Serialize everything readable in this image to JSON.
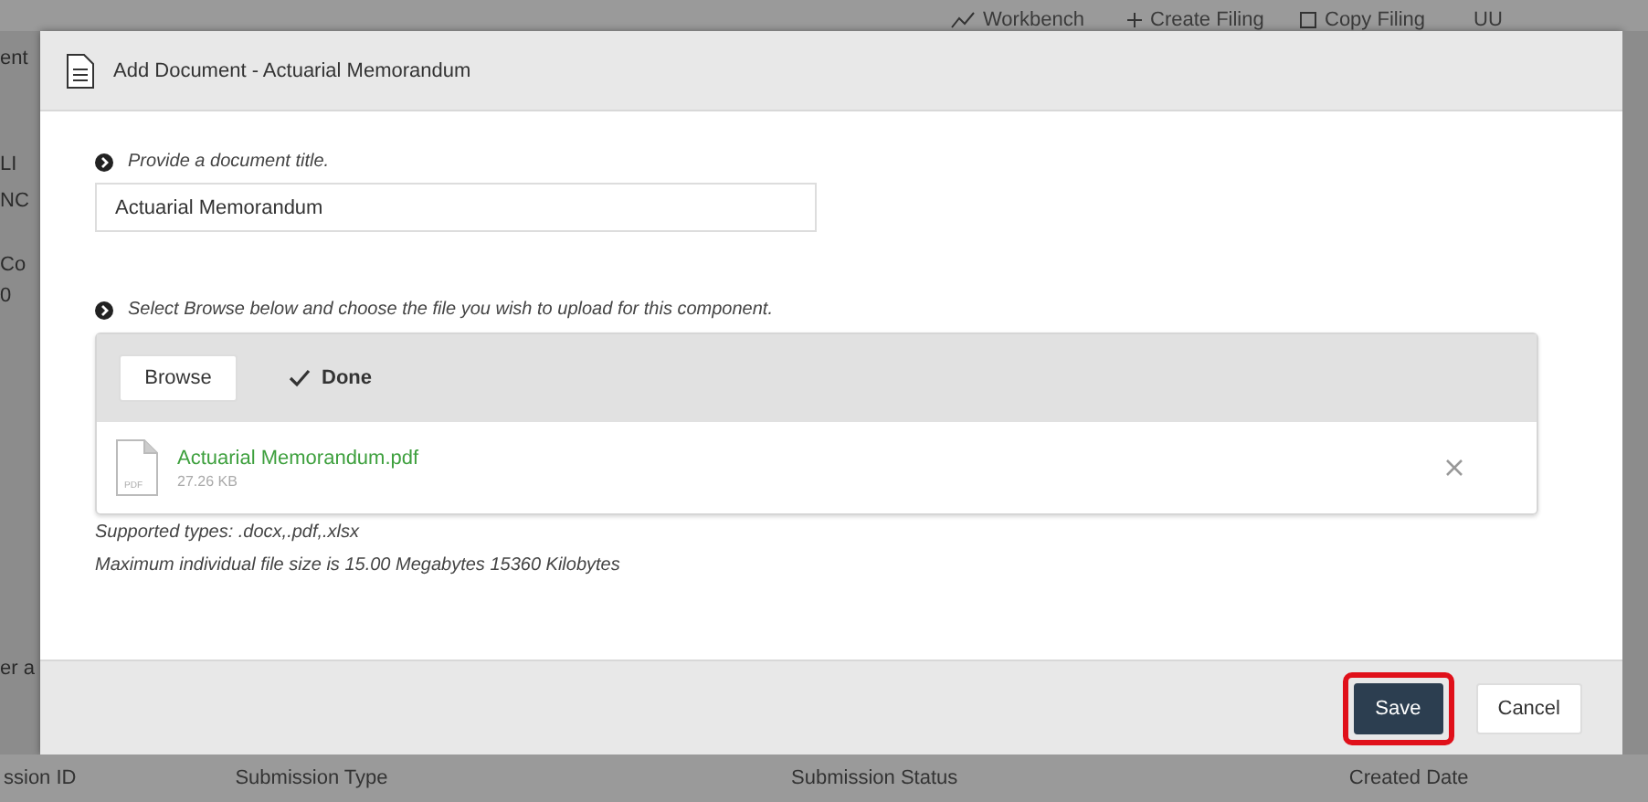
{
  "background": {
    "toolbar": [
      {
        "label": "Workbench",
        "kind": "chart"
      },
      {
        "label": "Create Filing",
        "kind": "plus"
      },
      {
        "label": "Copy Filing",
        "kind": "copy"
      },
      {
        "label": "UU",
        "kind": "cut"
      }
    ],
    "side_fragments": [
      "ent",
      "LI",
      "NC",
      "Co",
      "0",
      "er a"
    ],
    "columns": [
      "ssion ID",
      "Submission Type",
      "Submission Status",
      "Created Date"
    ]
  },
  "dialog": {
    "title": "Add Document - Actuarial Memorandum",
    "steps": [
      {
        "label": "Provide a document title."
      },
      {
        "label": "Select Browse below and choose the file you wish to upload for this component."
      }
    ],
    "title_field": {
      "value": "Actuarial Memorandum"
    },
    "upload": {
      "browse_label": "Browse",
      "status": "Done",
      "files": [
        {
          "name": "Actuarial Memorandum.pdf",
          "size": "27.26 KB",
          "type": "PDF"
        }
      ]
    },
    "notes": [
      "Supported types: .docx,.pdf,.xlsx",
      "Maximum individual file size is 15.00 Megabytes 15360 Kilobytes"
    ],
    "buttons": [
      {
        "label": "Save",
        "kind": "primary",
        "highlighted": true
      },
      {
        "label": "Cancel",
        "kind": "secondary",
        "highlighted": false
      }
    ]
  }
}
